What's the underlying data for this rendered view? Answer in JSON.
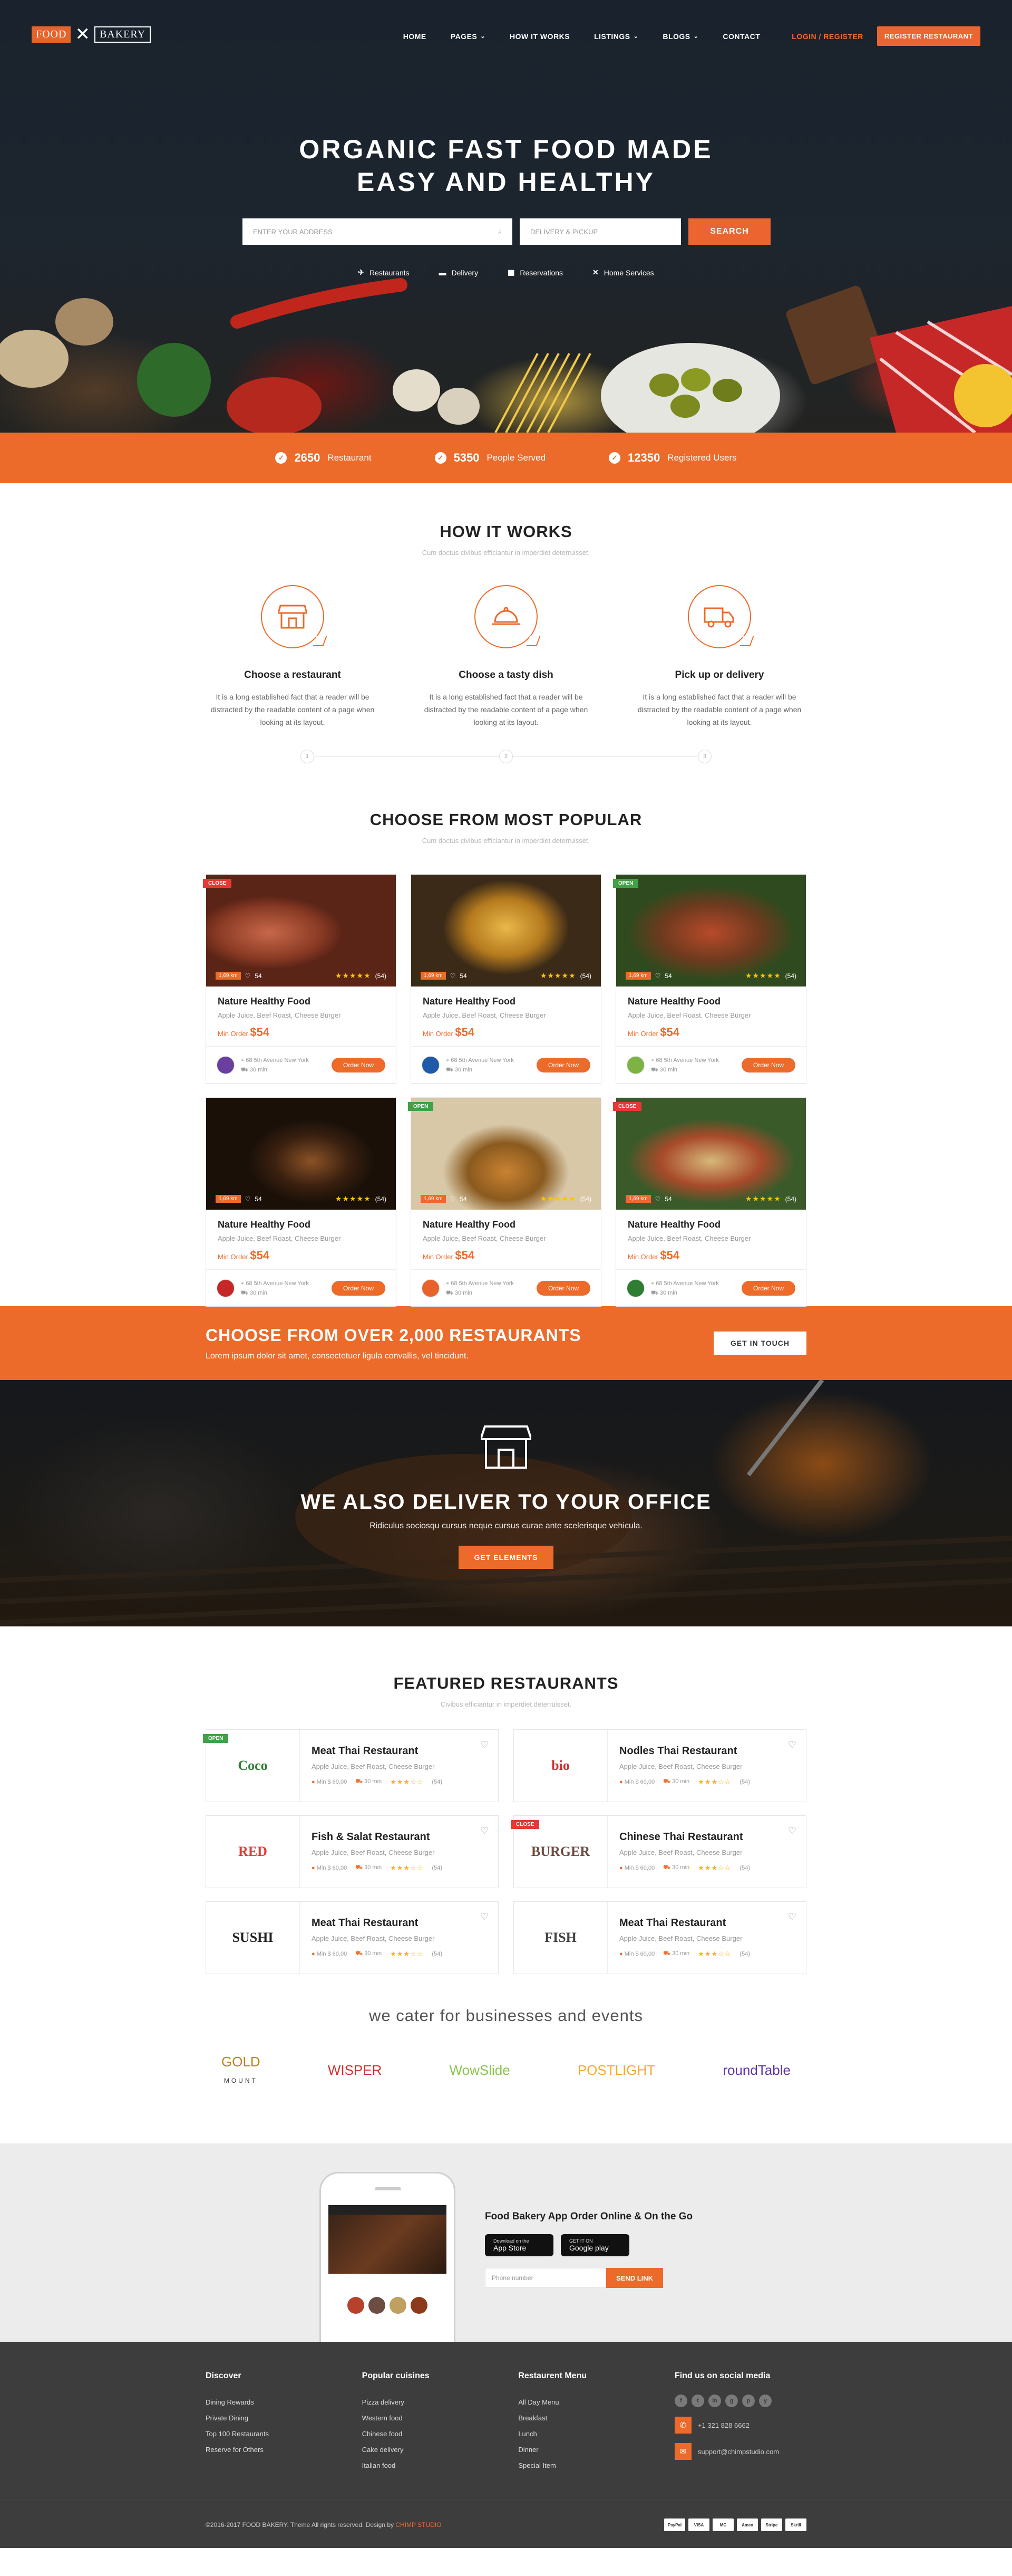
{
  "header": {
    "logo": {
      "left": "FOOD",
      "right": "BAKERY"
    },
    "nav": [
      {
        "label": "HOME",
        "dropdown": false
      },
      {
        "label": "PAGES",
        "dropdown": true
      },
      {
        "label": "HOW IT WORKS",
        "dropdown": false
      },
      {
        "label": "LISTINGS",
        "dropdown": true
      },
      {
        "label": "BLOGS",
        "dropdown": true
      },
      {
        "label": "CONTACT",
        "dropdown": false
      }
    ],
    "login": "LOGIN / REGISTER",
    "register": "REGISTER RESTAURANT"
  },
  "hero": {
    "title_line1": "ORGANIC FAST FOOD MADE",
    "title_line2": "EASY AND HEALTHY",
    "address_placeholder": "ENTER YOUR ADDRESS",
    "delivery_placeholder": "DELIVERY & PICKUP",
    "search_label": "SEARCH",
    "categories": [
      {
        "label": "Restaurants",
        "icon": "fork-knife-icon"
      },
      {
        "label": "Delivery",
        "icon": "truck-icon"
      },
      {
        "label": "Reservations",
        "icon": "calendar-icon"
      },
      {
        "label": "Home Services",
        "icon": "utensils-cross-icon"
      }
    ]
  },
  "stats": [
    {
      "value": "2650",
      "label": "Restaurant"
    },
    {
      "value": "5350",
      "label": "People Served"
    },
    {
      "value": "12350",
      "label": "Registered Users"
    }
  ],
  "how": {
    "title": "HOW IT WORKS",
    "subtitle": "Cum doctus civibus efficiantur in imperdiet deterruisset.",
    "steps": [
      {
        "title": "Choose a restaurant",
        "text": "It is a long established fact that a reader will be distracted by the readable content of a page when looking at its layout.",
        "icon": "storefront-icon"
      },
      {
        "title": "Choose a tasty dish",
        "text": "It is a long established fact that a reader will be distracted by the readable content of a page when looking at its layout.",
        "icon": "cloche-icon"
      },
      {
        "title": "Pick up or delivery",
        "text": "It is a long established fact that a reader will be distracted by the readable content of a page when looking at its layout.",
        "icon": "delivery-truck-icon"
      }
    ],
    "markers": [
      "1",
      "2",
      "3"
    ]
  },
  "popular": {
    "title": "CHOOSE FROM MOST POPULAR",
    "subtitle": "Cum doctus civibus efficiantur in imperdiet deterruisset.",
    "cards": [
      {
        "ribbon": "CLOSE",
        "ribbon_color": "#e53935",
        "tag": "1,69 km",
        "likes": "54",
        "rating": "(54)",
        "name": "Nature Healthy Food",
        "desc": "Apple Juice, Beef Roast, Cheese Burger",
        "min_label": "Min Order",
        "price": "$54",
        "address": "68 5th Avenue New York",
        "time": "30 min",
        "badge_color": "#6b3fa0",
        "photo": "a"
      },
      {
        "ribbon": "",
        "ribbon_color": "",
        "tag": "1,69 km",
        "likes": "54",
        "rating": "(54)",
        "name": "Nature Healthy Food",
        "desc": "Apple Juice, Beef Roast, Cheese Burger",
        "min_label": "Min Order",
        "price": "$54",
        "address": "68 5th Avenue New York",
        "time": "30 min",
        "badge_color": "#1e5aa8",
        "photo": "b"
      },
      {
        "ribbon": "OPEN",
        "ribbon_color": "#43a047",
        "tag": "1,69 km",
        "likes": "54",
        "rating": "(54)",
        "name": "Nature Healthy Food",
        "desc": "Apple Juice, Beef Roast, Cheese Burger",
        "min_label": "Min Order",
        "price": "$54",
        "address": "68 5th Avenue New York",
        "time": "30 min",
        "badge_color": "#7cb342",
        "photo": "c"
      },
      {
        "ribbon": "",
        "ribbon_color": "",
        "tag": "1,69 km",
        "likes": "54",
        "rating": "(54)",
        "name": "Nature Healthy Food",
        "desc": "Apple Juice, Beef Roast, Cheese Burger",
        "min_label": "Min Order",
        "price": "$54",
        "address": "68 5th Avenue New York",
        "time": "30 min",
        "badge_color": "#c62828",
        "photo": "d"
      },
      {
        "ribbon": "OPEN",
        "ribbon_color": "#43a047",
        "tag": "1,69 km",
        "likes": "54",
        "rating": "(54)",
        "name": "Nature Healthy Food",
        "desc": "Apple Juice, Beef Roast, Cheese Burger",
        "min_label": "Min Order",
        "price": "$54",
        "address": "68 5th Avenue New York",
        "time": "30 min",
        "badge_color": "#e8632b",
        "photo": "e"
      },
      {
        "ribbon": "CLOSE",
        "ribbon_color": "#e53935",
        "tag": "1,69 km",
        "likes": "54",
        "rating": "(54)",
        "name": "Nature Healthy Food",
        "desc": "Apple Juice, Beef Roast, Cheese Burger",
        "min_label": "Min Order",
        "price": "$54",
        "address": "68 5th Avenue New York",
        "time": "30 min",
        "badge_color": "#2e7d32",
        "photo": "f"
      }
    ],
    "order_label": "Order Now"
  },
  "cta": {
    "title": "CHOOSE FROM OVER 2,000 RESTAURANTS",
    "text": "Lorem ipsum dolor sit amet, consectetuer ligula convallis, vel tincidunt.",
    "button": "GET IN TOUCH"
  },
  "office": {
    "title": "WE ALSO DELIVER TO YOUR OFFICE",
    "text": "Ridiculus sociosqu cursus neque cursus curae ante scelerisque vehicula.",
    "button": "GET ELEMENTS"
  },
  "featured": {
    "title": "FEATURED RESTAURANTS",
    "subtitle": "Civibus efficiantur in imperdiet deterruisset.",
    "items": [
      {
        "name": "Meat Thai Restaurant",
        "desc": "Apple Juice, Beef Roast, Cheese Burger",
        "min": "Min $ 60,00",
        "time": "30 min",
        "rating": "(54)",
        "logo": "Coco",
        "logo_color": "#2e7d32",
        "ribbon": "OPEN",
        "ribbon_color": "#43a047"
      },
      {
        "name": "Nodles Thai Restaurant",
        "desc": "Apple Juice, Beef Roast, Cheese Burger",
        "min": "Min $ 60,00",
        "time": "30 min",
        "rating": "(54)",
        "logo": "bio",
        "logo_color": "#d32f2f",
        "ribbon": "",
        "ribbon_color": ""
      },
      {
        "name": "Fish & Salat Restaurant",
        "desc": "Apple Juice, Beef Roast, Cheese Burger",
        "min": "Min $ 60,00",
        "time": "30 min",
        "rating": "(54)",
        "logo": "RED",
        "logo_color": "#e53935",
        "ribbon": "",
        "ribbon_color": ""
      },
      {
        "name": "Chinese Thai Restaurant",
        "desc": "Apple Juice, Beef Roast, Cheese Burger",
        "min": "Min $ 60,00",
        "time": "30 min",
        "rating": "(54)",
        "logo": "BURGER",
        "logo_color": "#6d4c41",
        "ribbon": "CLOSE",
        "ribbon_color": "#e53935"
      },
      {
        "name": "Meat Thai Restaurant",
        "desc": "Apple Juice, Beef Roast, Cheese Burger",
        "min": "Min $ 60,00",
        "time": "30 min",
        "rating": "(54)",
        "logo": "SUSHI",
        "logo_color": "#222222",
        "ribbon": "",
        "ribbon_color": ""
      },
      {
        "name": "Meat Thai Restaurant",
        "desc": "Apple Juice, Beef Roast, Cheese Burger",
        "min": "Min $ 60,00",
        "time": "30 min",
        "rating": "(54)",
        "logo": "FISH",
        "logo_color": "#424242",
        "ribbon": "",
        "ribbon_color": ""
      }
    ]
  },
  "cater": {
    "title": "we cater for businesses and events",
    "brands": [
      {
        "name": "GOLD",
        "sub": "MOUNT",
        "color": "#b8860b"
      },
      {
        "name": "WISPER",
        "sub": "",
        "color": "#d32f2f"
      },
      {
        "name": "WowSlide",
        "sub": "",
        "color": "#8bc34a"
      },
      {
        "name": "POSTLIGHT",
        "sub": "",
        "color": "#f9a825"
      },
      {
        "name": "roundTable",
        "sub": "",
        "color": "#5e35b1"
      }
    ]
  },
  "app": {
    "title": "Food Bakery App Order Online & On the Go",
    "appstore_small": "Download on the",
    "appstore": "App Store",
    "googleplay_small": "GET IT ON",
    "googleplay": "Google play",
    "phone_placeholder": "Phone number",
    "send_label": "SEND LINK"
  },
  "footer": {
    "cols": [
      {
        "title": "Discover",
        "items": [
          "Dining Rewards",
          "Private Dining",
          "Top 100 Restaurants",
          "Reserve for Others"
        ]
      },
      {
        "title": "Popular cuisines",
        "items": [
          "Pizza delivery",
          "Western food",
          "Chinese food",
          "Cake delivery",
          "Italian food"
        ]
      },
      {
        "title": "Restaurent Menu",
        "items": [
          "All Day Menu",
          "Breakfast",
          "Lunch",
          "Dinner",
          "Special Item"
        ]
      }
    ],
    "social_title": "Find us on social media",
    "social": [
      "f",
      "t",
      "in",
      "g",
      "p",
      "y"
    ],
    "phone": "+1 321 828 6662",
    "email": "support@chimpstudio.com",
    "copyright": "©2016-2017 FOOD BAKERY. Theme All rights reserved. Design by",
    "designer": "CHIMP STUDIO",
    "payments": [
      "PayPal",
      "VISA",
      "MC",
      "Amex",
      "Stripe",
      "Skrill"
    ]
  },
  "colors": {
    "accent": "#ec6a2a",
    "open": "#43a047",
    "close": "#e53935"
  }
}
